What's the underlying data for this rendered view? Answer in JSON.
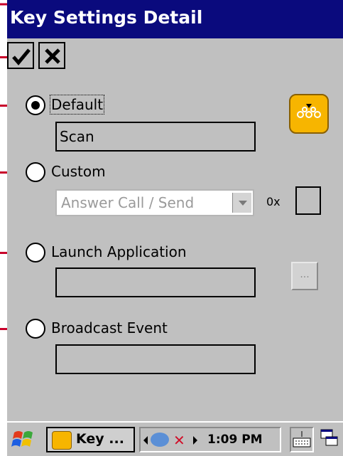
{
  "window": {
    "title": "Key Settings Detail"
  },
  "toolbar": {
    "ok_icon": "checkmark-icon",
    "cancel_icon": "x-icon"
  },
  "options": {
    "default": {
      "label": "Default",
      "selected": true,
      "value": "Scan"
    },
    "custom": {
      "label": "Custom",
      "selected": false,
      "combo_value": "Answer Call / Send",
      "hex_prefix": "0x",
      "hex_value": ""
    },
    "launch": {
      "label": "Launch Application",
      "selected": false,
      "value": "",
      "browse_label": "..."
    },
    "broadcast": {
      "label": "Broadcast Event",
      "selected": false,
      "value": ""
    }
  },
  "taskbar": {
    "start_icon": "windows-flag-icon",
    "task_label": "Key ...",
    "clock": "1:09 PM",
    "keyboard_icon": "keyboard-icon",
    "windows_icon": "window-switch-icon"
  },
  "colors": {
    "titlebar": "#0a0a7d",
    "annotation": "#c8002a",
    "key_icon": "#f7b500",
    "background": "#c0c0c0"
  }
}
